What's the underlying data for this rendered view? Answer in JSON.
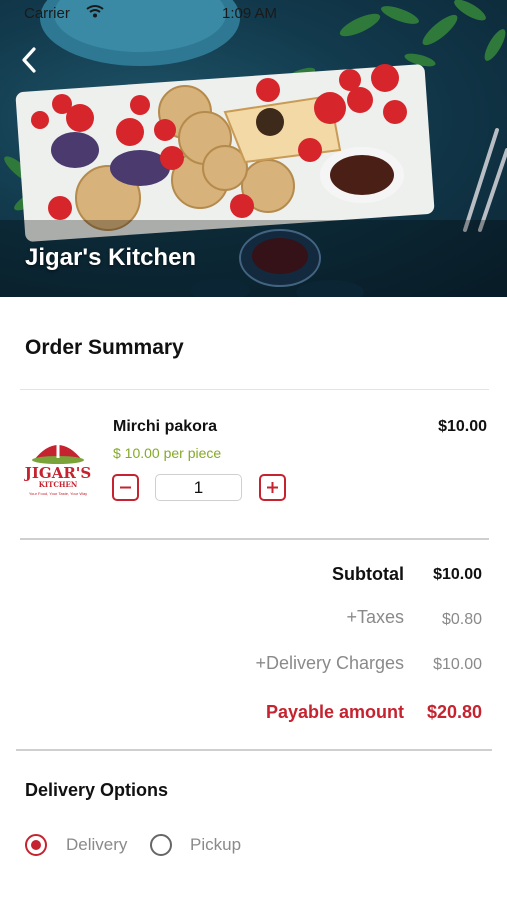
{
  "status_bar": {
    "carrier": "Carrier",
    "time": "1:09 AM"
  },
  "hero": {
    "title": "Jigar's Kitchen",
    "back_icon": "chevron-left-icon"
  },
  "order_summary": {
    "title": "Order Summary",
    "items": [
      {
        "name": "Mirchi pakora",
        "unit_price": "$ 10.00 per piece",
        "price": "$10.00",
        "quantity": "1",
        "logo": {
          "brand": "JIGAR'S",
          "sub": "KITCHEN",
          "tagline": "Your Food, Your Taste, Your Way"
        }
      }
    ]
  },
  "totals": {
    "subtotal_label": "Subtotal",
    "subtotal_value": "$10.00",
    "taxes_label": "+Taxes",
    "taxes_value": "$0.80",
    "delivery_label": "+Delivery Charges",
    "delivery_value": "$10.00",
    "payable_label": "Payable amount",
    "payable_value": "$20.80"
  },
  "delivery_options": {
    "title": "Delivery Options",
    "options": [
      {
        "label": "Delivery",
        "selected": true
      },
      {
        "label": "Pickup",
        "selected": false
      }
    ]
  },
  "colors": {
    "accent": "#c4232f",
    "unit_price": "#86a92a",
    "muted": "#8a8a8a"
  }
}
